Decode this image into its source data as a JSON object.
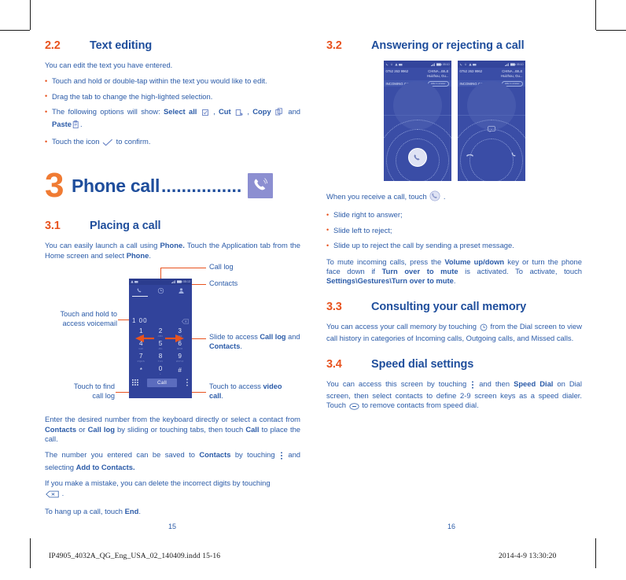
{
  "document": {
    "left_page_number": "15",
    "right_page_number": "16",
    "imprint_left": "IP4905_4032A_QG_Eng_USA_02_140409.indd   15-16",
    "imprint_right": "2014-4-9   13:30:20"
  },
  "colors": {
    "accent_orange": "#E8531F",
    "heading_blue": "#1F4E9C",
    "body_blue": "#2B5BA8",
    "phone_screen": "#31439B",
    "chapter_icon_bg": "#8C8FD1"
  },
  "left_column": {
    "section_2_2": {
      "number": "2.2",
      "title": "Text editing",
      "intro": "You can edit the text you have entered.",
      "bullets": [
        {
          "text_before": "Touch and hold or double-tap within the text you would like to edit.",
          "text_after": ""
        },
        {
          "text_before": "Drag the tab to change the high-lighted selection.",
          "text_after": ""
        },
        {
          "text_before": "The following options will show: ",
          "b1": "Select all",
          "mid1": " , ",
          "b2": "Cut",
          "mid2": " , ",
          "b3": "Copy",
          "mid3": " and ",
          "b4": "Paste",
          "text_after": "."
        },
        {
          "text_before": "Touch the icon ",
          "text_after": " to confirm."
        }
      ]
    },
    "chapter": {
      "number": "3",
      "title": "Phone call",
      "dots": "................",
      "icon": "phone-handset-icon"
    },
    "section_3_1": {
      "number": "3.1",
      "title": "Placing a call",
      "intro_1": "You can easily launch a call using ",
      "intro_b1": "Phone.",
      "intro_2": " Touch the Application tab from the Home screen and select ",
      "intro_b2": "Phone",
      "intro_3": ".",
      "figure": {
        "callouts": {
          "call_log": "Call log",
          "contacts": "Contacts",
          "voicemail_line1": "Touch and hold to",
          "voicemail_line2": "access voicemail",
          "slide_pre": "Slide to access ",
          "slide_b1": "Call log",
          "slide_mid": " and ",
          "slide_b2": "Contacts",
          "slide_post": ".",
          "find_line1": "Touch to find",
          "find_line2": "call log",
          "video_pre": "Touch to access ",
          "video_b": "video",
          "video_post": "call",
          "video_post_dot": "."
        },
        "dialer": {
          "status_time": "05:13",
          "entered_number": "1 00",
          "keys": [
            {
              "digit": "1",
              "sub": "∞"
            },
            {
              "digit": "2",
              "sub": "ABC"
            },
            {
              "digit": "3",
              "sub": "DEF"
            },
            {
              "digit": "4",
              "sub": "GHI"
            },
            {
              "digit": "5",
              "sub": "JKL"
            },
            {
              "digit": "6",
              "sub": "MNO"
            },
            {
              "digit": "7",
              "sub": "PQRS"
            },
            {
              "digit": "8",
              "sub": "TUV"
            },
            {
              "digit": "9",
              "sub": "WXYZ"
            },
            {
              "digit": "*",
              "sub": ""
            },
            {
              "digit": "0",
              "sub": "+"
            },
            {
              "digit": "#",
              "sub": ""
            }
          ],
          "call_button": "Call",
          "tabs": [
            "dialpad-icon",
            "call-log-clock-icon",
            "contacts-person-icon"
          ]
        }
      },
      "para_2_a": "Enter the desired number from the keyboard directly or select a contact from ",
      "para_2_b1": "Contacts",
      "para_2_c": " or ",
      "para_2_b2": "Call log",
      "para_2_d": " by sliding or touching tabs, then touch ",
      "para_2_b3": "Call",
      "para_2_e": " to place the call.",
      "para_3_a": "The number you entered can be saved to ",
      "para_3_b1": "Contacts",
      "para_3_c": " by touching ",
      "para_3_d": " and selecting ",
      "para_3_b2": "Add to Contacts.",
      "para_4_a": "If you make a mistake, you can delete the incorrect digits by touching ",
      "para_4_b": " .",
      "para_5_a": "To hang up a call, touch ",
      "para_5_b": "End",
      "para_5_c": "."
    }
  },
  "right_column": {
    "section_3_2": {
      "number": "3.2",
      "title": "Answering or rejecting a call",
      "phones": [
        {
          "number": "0752 263 9962",
          "carrier_line1": "CHINA...BILE",
          "carrier_line2": "Huizhou, Gu...",
          "status_time": "05:10",
          "incoming_label": "INCOMING CALL",
          "chip_label": "slide to answer",
          "variant": "answer"
        },
        {
          "number": "0752 263 9962",
          "carrier_line1": "CHINA...BILE",
          "carrier_line2": "Huizhou, Gu...",
          "status_time": "05:10",
          "incoming_label": "INCOMING CALL",
          "chip_label": "slide to answer",
          "variant": "options"
        }
      ],
      "lead_a": "When you receive a call, touch ",
      "lead_b": " .",
      "bullets": [
        "Slide right to answer;",
        "Slide left to reject;",
        "Slide up to reject the call by sending a preset message."
      ],
      "para_a": "To mute incoming calls, press the ",
      "para_b1": "Volume up/down",
      "para_c": " key or turn the phone face down if ",
      "para_b2": "Turn over to mute",
      "para_d": " is activated. To activate, touch ",
      "para_b3": "Settings\\Gestures\\Turn over to mute",
      "para_e": "."
    },
    "section_3_3": {
      "number": "3.3",
      "title": "Consulting your call memory",
      "para_a": "You can access your call memory by touching ",
      "para_b": " from the Dial screen to view call history in categories of Incoming calls, Outgoing calls, and Missed calls."
    },
    "section_3_4": {
      "number": "3.4",
      "title": "Speed dial settings",
      "para_a": "You can access this screen by touching ",
      "para_b": " and then  ",
      "para_bold1": "Speed Dial",
      "para_c": " on Dial screen, then select contacts to define 2-9 screen keys as a speed dialer. Touch ",
      "para_d": " to remove contacts from speed dial."
    }
  }
}
